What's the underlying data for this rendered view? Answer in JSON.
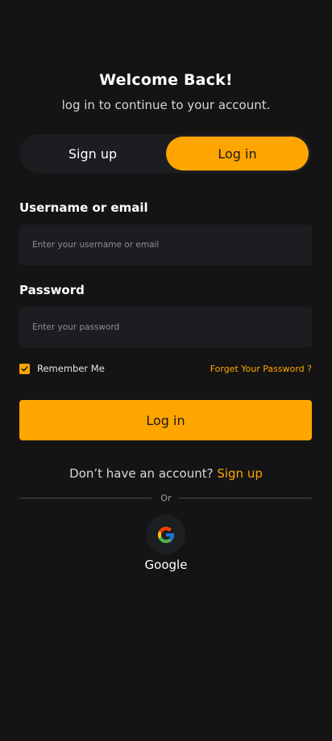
{
  "header": {
    "title": "Welcome Back!",
    "subtitle": "log in to continue to your account."
  },
  "toggle": {
    "signup_label": "Sign up",
    "login_label": "Log in",
    "active": "Log in"
  },
  "form": {
    "username_label": "Username or email",
    "username_placeholder": "Enter your username or email",
    "username_value": "",
    "password_label": "Password",
    "password_placeholder": "Enter your password",
    "password_value": "",
    "remember_label": "Remember Me",
    "remember_checked": true,
    "forgot_label": "Forget Your Password ?",
    "submit_label": "Log in"
  },
  "footer": {
    "no_account_text": "Don’t have an account?",
    "signup_link": "Sign up",
    "divider_text": "Or",
    "google_label": "Google",
    "google_icon": "google-logo-icon"
  },
  "colors": {
    "background": "#141414",
    "accent": "#ffa500",
    "surface": "#1b1d20"
  }
}
